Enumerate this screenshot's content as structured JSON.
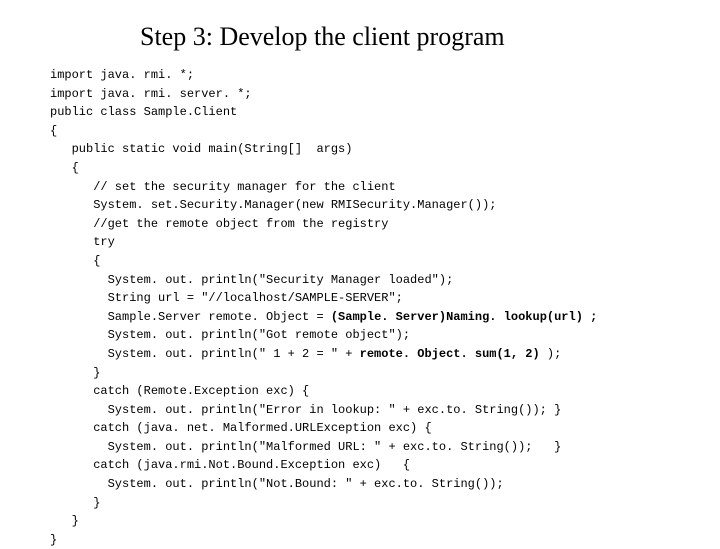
{
  "title": "Step 3: Develop the client program",
  "code": {
    "l01": "import java. rmi. *;",
    "l02": "import java. rmi. server. *;",
    "l03": "public class Sample.Client",
    "l04": "{",
    "l05": "   public static void main(String[]  args)",
    "l06": "   {",
    "l07": "      // set the security manager for the client",
    "l08": "      System. set.Security.Manager(new RMISecurity.Manager());",
    "l09": "      //get the remote object from the registry",
    "l10": "      try",
    "l11": "      {",
    "l12": "        System. out. println(\"Security Manager loaded\");",
    "l13": "        String url = \"//localhost/SAMPLE-SERVER\";",
    "l14a": "        Sample.Server remote. Object = ",
    "l14b": "(Sample. Server)Naming. lookup(url) ;",
    "l15": "        System. out. println(\"Got remote object\");",
    "l16a": "        System. out. println(\" 1 + 2 = \" + ",
    "l16b": "remote. Object. sum(1, 2) ",
    "l16c": ");",
    "l17": "      }",
    "l18": "      catch (Remote.Exception exc) {",
    "l19": "        System. out. println(\"Error in lookup: \" + exc.to. String()); }",
    "l20": "      catch (java. net. Malformed.URLException exc) {",
    "l21": "        System. out. println(\"Malformed URL: \" + exc.to. String());   }",
    "l22": "      catch (java.rmi.Not.Bound.Exception exc)   {",
    "l23": "        System. out. println(\"Not.Bound: \" + exc.to. String());",
    "l24": "      }",
    "l25": "   }",
    "l26": "}"
  }
}
